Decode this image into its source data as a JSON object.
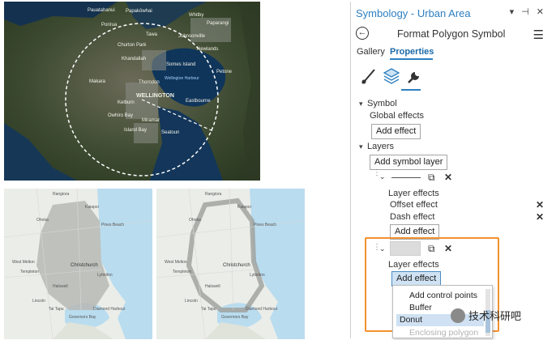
{
  "maps": {
    "wellington": {
      "labels": [
        "Pauatahanui",
        "Papakōwhai",
        "Porirua",
        "Whitby",
        "Paparangi",
        "Tawa",
        "Churton Park",
        "Johnsonville",
        "Newlands",
        "Khandallah",
        "Somes Island",
        "Petone",
        "Makara",
        "Thorndon",
        "Wellington Harbour",
        "WELLINGTON",
        "Kelburn",
        "Eastbourne",
        "Owhiro Bay",
        "Island Bay",
        "Miramar",
        "Seatoun"
      ]
    },
    "christchurch": {
      "labels": [
        "Rangiora",
        "Kaiapoi",
        "Pines Beach",
        "Ohoka",
        "West Melton",
        "Christchurch",
        "Templeton",
        "Lincoln",
        "Tai Tapu",
        "Lyttelton",
        "Diamond Harbour",
        "Governors Bay",
        "Halswell"
      ]
    }
  },
  "pane": {
    "title": "Symbology - Urban Area",
    "title_icons": "▾ ⊣ ✕",
    "subtitle": "Format Polygon Symbol",
    "tabs": {
      "gallery": "Gallery",
      "properties": "Properties"
    },
    "symbol": {
      "header": "Symbol",
      "global_effects": "Global effects",
      "add_effect": "Add effect"
    },
    "layers": {
      "header": "Layers",
      "add_symbol_layer": "Add symbol layer",
      "layer1": {
        "effects_label": "Layer effects",
        "effects": [
          "Offset effect",
          "Dash effect"
        ],
        "add_effect": "Add effect"
      },
      "layer2": {
        "effects_label": "Layer effects",
        "add_effect": "Add effect"
      }
    },
    "dropdown": {
      "options": [
        "Add control points",
        "Buffer",
        "Donut",
        "Enclosing polygon"
      ],
      "selected": "Donut"
    }
  },
  "watermark": {
    "text": "技术科研吧"
  },
  "colors": {
    "accent": "#2d7fc1",
    "highlight": "#f3922f"
  }
}
